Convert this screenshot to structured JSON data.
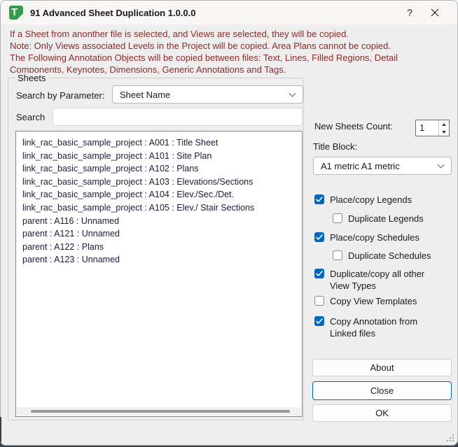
{
  "window": {
    "title": "91 Advanced Sheet Duplication 1.0.0.0",
    "help_label": "?"
  },
  "notice": {
    "line1": "If a Sheet from anonther file is selected, and Views are selected, they will be copied.",
    "line2": "Note: Only Views associated Levels in the Project will be copied. Area Plans cannot be copied.",
    "line3": "The Following Annotation Objects will be copied between files: Text, Lines, Filled Regions, Detail",
    "line4": "Components, Keynotes, Dimensions, Generic Annotations and Tags."
  },
  "sheets_group": {
    "label": "Sheets",
    "search_by_parameter_label": "Search by Parameter:",
    "parameter_value": "Sheet Name",
    "search_label": "Search",
    "search_value": "",
    "items": [
      "link_rac_basic_sample_project : A001 : Title Sheet",
      "link_rac_basic_sample_project : A101 : Site Plan",
      "link_rac_basic_sample_project : A102 : Plans",
      "link_rac_basic_sample_project : A103 : Elevations/Sections",
      "link_rac_basic_sample_project : A104 : Elev./Sec./Det.",
      "link_rac_basic_sample_project : A105 : Elev./ Stair Sections",
      "parent : A116 : Unnamed",
      "parent : A121 : Unnamed",
      "parent : A122 : Plans",
      "parent : A123 : Unnamed"
    ]
  },
  "right_panel": {
    "new_sheets_count_label": "New Sheets Count:",
    "new_sheets_count_value": "1",
    "title_block_label": "Title Block:",
    "title_block_value": "A1 metric A1 metric",
    "checkboxes": [
      {
        "label": "Place/copy Legends",
        "checked": true,
        "indent": false
      },
      {
        "label": "Duplicate Legends",
        "checked": false,
        "indent": true
      },
      {
        "label": "Place/copy Schedules",
        "checked": true,
        "indent": false
      },
      {
        "label": "Duplicate Schedules",
        "checked": false,
        "indent": true
      },
      {
        "label": "Duplicate/copy all other View Types",
        "checked": true,
        "indent": false
      },
      {
        "label": "Copy View Templates",
        "checked": false,
        "indent": false
      },
      {
        "label": "Copy Annotation from Linked files",
        "checked": true,
        "indent": false
      }
    ],
    "buttons": {
      "about": "About",
      "close": "Close",
      "ok": "OK"
    }
  },
  "colors": {
    "accent": "#0067c0",
    "notice_text": "#8b2a2a",
    "list_text": "#1b1c3a",
    "icon_green": "#2f9e4c"
  }
}
